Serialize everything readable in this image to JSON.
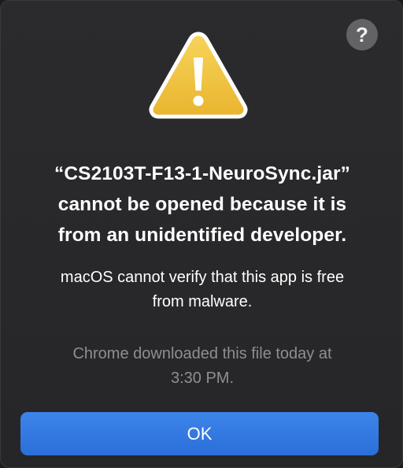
{
  "dialog": {
    "help_label": "?",
    "warning_icon": "warning-triangle-icon",
    "title_lines": [
      "“CS2103T-F13-1-NeuroSync.jar”",
      "cannot be opened because it is",
      "from an unidentified developer."
    ],
    "message_lines": [
      "macOS cannot verify that this app is free",
      "from malware."
    ],
    "footnote_lines": [
      "Chrome downloaded this file today at",
      "3:30 PM."
    ],
    "ok_label": "OK"
  },
  "colors": {
    "background": "#2a2a2c",
    "accent": "#3479e6",
    "warning_fill": "#f2c445",
    "secondary_text": "#8e8e93"
  }
}
